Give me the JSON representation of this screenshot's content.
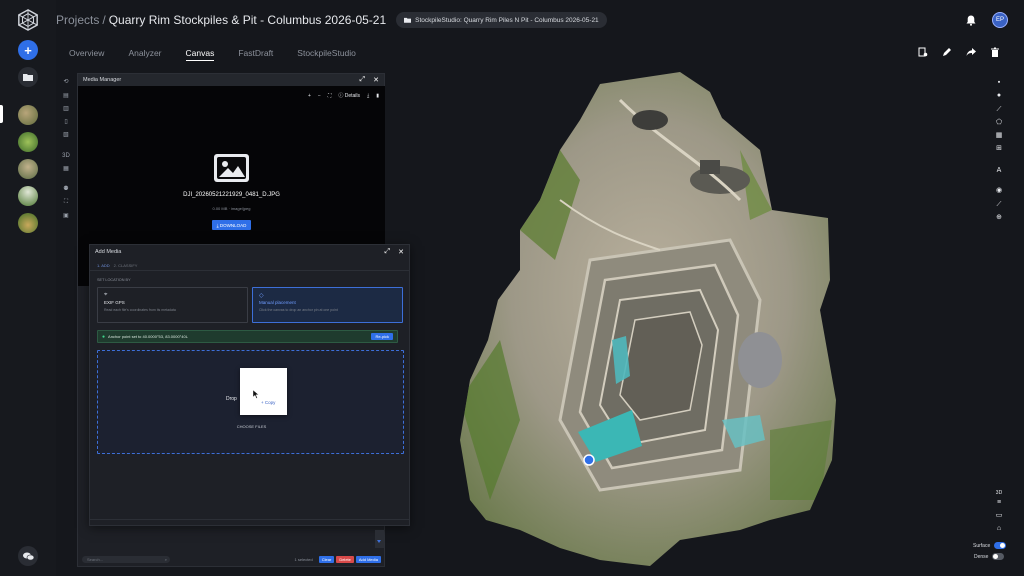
{
  "header": {
    "breadcrumb_root": "Projects",
    "separator": "/",
    "project_title": "Quarry Rim Stockpiles & Pit - Columbus 2026-05-21",
    "chip_label": "StockpileStudio: Quarry Rim Piles N Pit - Columbus 2026-05-21",
    "avatar_initials": "EP"
  },
  "tabs": [
    {
      "label": "Overview"
    },
    {
      "label": "Analyzer"
    },
    {
      "label": "Canvas",
      "active": true
    },
    {
      "label": "FastDraft"
    },
    {
      "label": "StockpileStudio"
    }
  ],
  "media_manager": {
    "title": "Media Manager",
    "details_label": "Details",
    "file_name": "DJI_20260521221929_0481_D.JPG",
    "file_meta": "0.00 MB · image/jpeg",
    "download_label": "DOWNLOAD",
    "search_placeholder": "Search...",
    "selected_count": "1 selected",
    "clear_label": "Clear",
    "delete_label": "Delete",
    "add_media_label": "Add Media"
  },
  "add_media": {
    "title": "Add Media",
    "step1": "1. ADD",
    "step2": "2. CLASSIFY",
    "set_location_label": "SET LOCATION BY",
    "options": [
      {
        "title": "EXIF GPS",
        "desc": "Read each file's coordinates from its metadata"
      },
      {
        "title": "Manual placement",
        "desc": "Click the canvas to drop an anchor pin at one point",
        "selected": true
      }
    ],
    "anchor_text": "Anchor point set to 40.0000°53, 83.0000°40L",
    "repick_label": "Re-pick",
    "drop_text": "Drop",
    "copy_label": "+ Copy",
    "choose_label": "CHOOSE FILES"
  },
  "map_toggles": {
    "view_3d": "3D",
    "surface_label": "Surface",
    "dense_label": "Dense",
    "surface_on": true,
    "dense_on": false
  },
  "colors": {
    "accent": "#2f6fe8",
    "danger": "#d84a4a",
    "success": "#3dd68c"
  }
}
